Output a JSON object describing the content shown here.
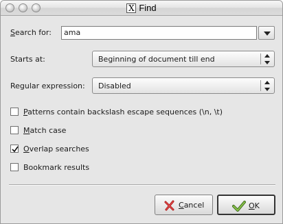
{
  "window": {
    "title": "Find",
    "title_icon": "x-window-icon"
  },
  "search": {
    "label_mnemonic": "S",
    "label_rest": "earch for:",
    "value": "ama"
  },
  "starts_at": {
    "label": "Starts at:",
    "value": "Beginning of document till end"
  },
  "regex": {
    "label": "Regular expression:",
    "value": "Disabled"
  },
  "options": [
    {
      "mnemonic": "P",
      "rest": "atterns contain backslash escape sequences (\\n, \\t)",
      "checked": false
    },
    {
      "mnemonic": "M",
      "rest": "atch case",
      "checked": false
    },
    {
      "mnemonic": "O",
      "rest": "verlap searches",
      "checked": true
    },
    {
      "mnemonic": "",
      "rest": "Bookmark results",
      "checked": false
    }
  ],
  "buttons": {
    "cancel": {
      "mnemonic": "C",
      "rest": "ancel",
      "icon": "red-x-icon"
    },
    "ok": {
      "mnemonic": "O",
      "rest": "K",
      "icon": "green-check-icon"
    }
  }
}
